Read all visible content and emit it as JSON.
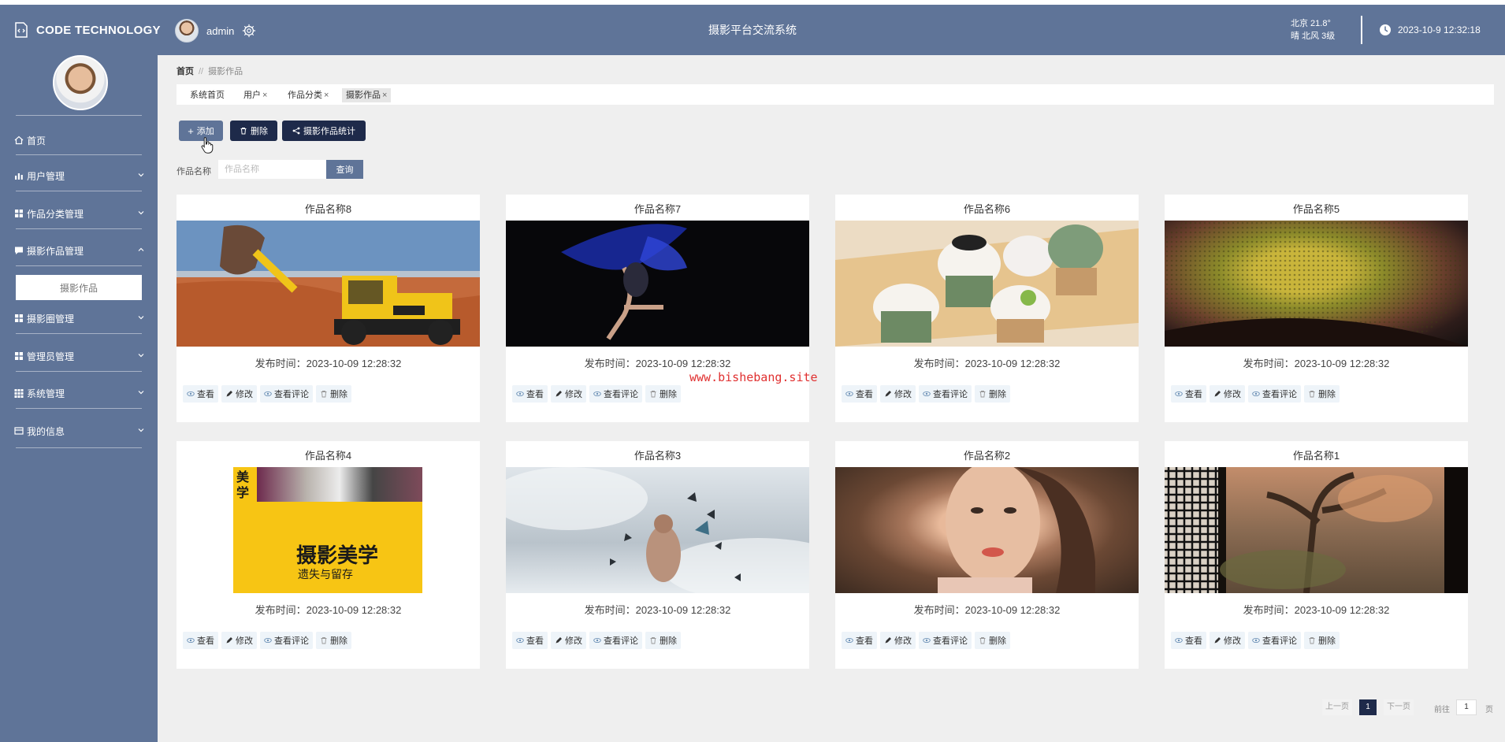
{
  "app": {
    "logo_text": "CODE TECHNOLOGY",
    "system_title": "摄影平台交流系统",
    "user_name": "admin",
    "weather_line1": "北京  21.8°",
    "weather_line2": "晴  北风  3级",
    "datetime": "2023-10-9 12:32:18"
  },
  "sidebar": {
    "items": [
      {
        "label": "首页",
        "icon": "home-icon"
      },
      {
        "label": "用户管理",
        "icon": "bar-chart-icon"
      },
      {
        "label": "作品分类管理",
        "icon": "grid-icon"
      },
      {
        "label": "摄影作品管理",
        "icon": "comment-icon"
      },
      {
        "label": "摄影圈管理",
        "icon": "grid-icon"
      },
      {
        "label": "管理员管理",
        "icon": "grid-icon"
      },
      {
        "label": "系统管理",
        "icon": "apps-icon"
      },
      {
        "label": "我的信息",
        "icon": "card-icon"
      }
    ],
    "submenu_active": "摄影作品"
  },
  "breadcrumb": {
    "home": "首页",
    "sep": "//",
    "current": "摄影作品"
  },
  "tabs": [
    {
      "label": "系统首页",
      "closable": false
    },
    {
      "label": "用户",
      "closable": true
    },
    {
      "label": "作品分类",
      "closable": true
    },
    {
      "label": "摄影作品",
      "closable": true,
      "active": true
    }
  ],
  "toolbar": {
    "add": "添加",
    "delete": "删除",
    "stats": "摄影作品统计"
  },
  "search": {
    "label": "作品名称",
    "placeholder": "作品名称",
    "button": "查询"
  },
  "card_actions": {
    "view": "查看",
    "edit": "修改",
    "comments": "查看评论",
    "delete": "删除"
  },
  "cards": [
    {
      "title": "作品名称8",
      "time": "发布时间：2023-10-09 12:28:32"
    },
    {
      "title": "作品名称7",
      "time": "发布时间：2023-10-09 12:28:32"
    },
    {
      "title": "作品名称6",
      "time": "发布时间：2023-10-09 12:28:32"
    },
    {
      "title": "作品名称5",
      "time": "发布时间：2023-10-09 12:28:32"
    },
    {
      "title": "作品名称4",
      "time": "发布时间：2023-10-09 12:28:32",
      "book_title": "摄影美学",
      "book_subtitle": "遗失与留存",
      "book_side": "美学"
    },
    {
      "title": "作品名称3",
      "time": "发布时间：2023-10-09 12:28:32"
    },
    {
      "title": "作品名称2",
      "time": "发布时间：2023-10-09 12:28:32"
    },
    {
      "title": "作品名称1",
      "time": "发布时间：2023-10-09 12:28:32"
    }
  ],
  "watermark": "www.bishebang.site",
  "pagination": {
    "prev": "上一页",
    "current": "1",
    "next": "下一页",
    "goto_label": "前往",
    "goto_value": "1",
    "page_unit": "页"
  },
  "colors": {
    "primary": "#5f7498",
    "dark": "#1e2a4a",
    "background": "#efefef"
  }
}
